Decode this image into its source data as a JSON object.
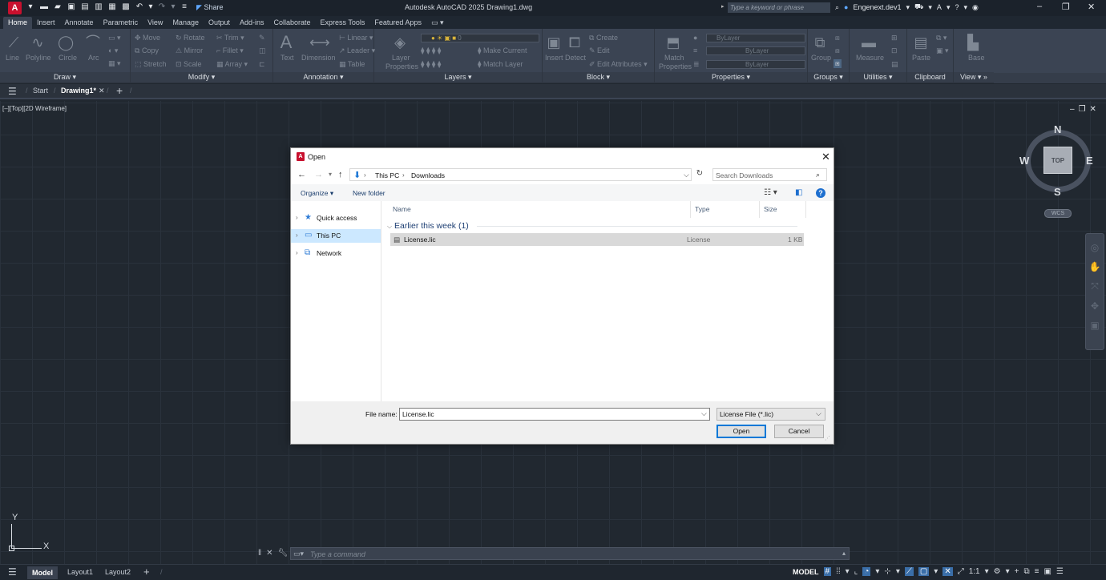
{
  "app": {
    "title": "Autodesk AutoCAD 2025   Drawing1.dwg",
    "logo_letter": "A",
    "share_label": "Share",
    "search_placeholder": "Type a keyword or phrase",
    "user": "Engenext.dev1"
  },
  "ribbon_tabs": [
    "Home",
    "Insert",
    "Annotate",
    "Parametric",
    "View",
    "Manage",
    "Output",
    "Add-ins",
    "Collaborate",
    "Express Tools",
    "Featured Apps"
  ],
  "ribbon": {
    "draw": {
      "title": "Draw",
      "line": "Line",
      "polyline": "Polyline",
      "circle": "Circle",
      "arc": "Arc"
    },
    "modify": {
      "title": "Modify",
      "move": "Move",
      "rotate": "Rotate",
      "trim": "Trim",
      "copy": "Copy",
      "mirror": "Mirror",
      "fillet": "Fillet",
      "stretch": "Stretch",
      "scale": "Scale",
      "array": "Array"
    },
    "annotation": {
      "title": "Annotation",
      "text": "Text",
      "dimension": "Dimension",
      "linear": "Linear",
      "leader": "Leader",
      "table": "Table"
    },
    "layers": {
      "title": "Layers",
      "layer_properties_1": "Layer",
      "layer_properties_2": "Properties",
      "make_current": "Make Current",
      "match_layer": "Match Layer",
      "layer_value": "0"
    },
    "block": {
      "title": "Block",
      "insert": "Insert",
      "detect": "Detect",
      "create": "Create",
      "edit": "Edit",
      "edit_attributes": "Edit Attributes"
    },
    "properties": {
      "title": "Properties",
      "match_1": "Match",
      "match_2": "Properties",
      "bylayer_color": "ByLayer",
      "bylayer_line1": "ByLayer",
      "bylayer_line2": "ByLayer"
    },
    "groups": {
      "title": "Groups",
      "group": "Group"
    },
    "utilities": {
      "title": "Utilities",
      "measure": "Measure"
    },
    "clipboard": {
      "title": "Clipboard",
      "paste": "Paste"
    },
    "view": {
      "title": "View",
      "base": "Base"
    }
  },
  "doc_tabs": {
    "start": "Start",
    "drawing": "Drawing1*"
  },
  "viewport": {
    "label": "[–][Top][2D Wireframe]"
  },
  "viewcube": {
    "n": "N",
    "s": "S",
    "e": "E",
    "w": "W",
    "top": "TOP",
    "wcs": "WCS"
  },
  "ucs": {
    "x": "X",
    "y": "Y"
  },
  "command": {
    "placeholder": "Type a command"
  },
  "status_tabs": {
    "model": "Model",
    "layout1": "Layout1",
    "layout2": "Layout2"
  },
  "status_right": {
    "model": "MODEL",
    "scale": "1:1"
  },
  "dialog": {
    "title": "Open",
    "breadcrumb": [
      "This PC",
      "Downloads"
    ],
    "search_placeholder": "Search Downloads",
    "organize": "Organize",
    "new_folder": "New folder",
    "nav": [
      {
        "label": "Quick access",
        "icon": "star-icon"
      },
      {
        "label": "This PC",
        "icon": "monitor-icon",
        "selected": true
      },
      {
        "label": "Network",
        "icon": "network-icon"
      }
    ],
    "columns": [
      "Name",
      "Type",
      "Size"
    ],
    "group": "Earlier this week (1)",
    "files": [
      {
        "name": "License.lic",
        "type": "License",
        "size": "1 KB"
      }
    ],
    "file_name_label": "File name:",
    "file_name_value": "License.lic",
    "file_type": "License File (*.lic)",
    "open_label": "Open",
    "cancel_label": "Cancel"
  }
}
